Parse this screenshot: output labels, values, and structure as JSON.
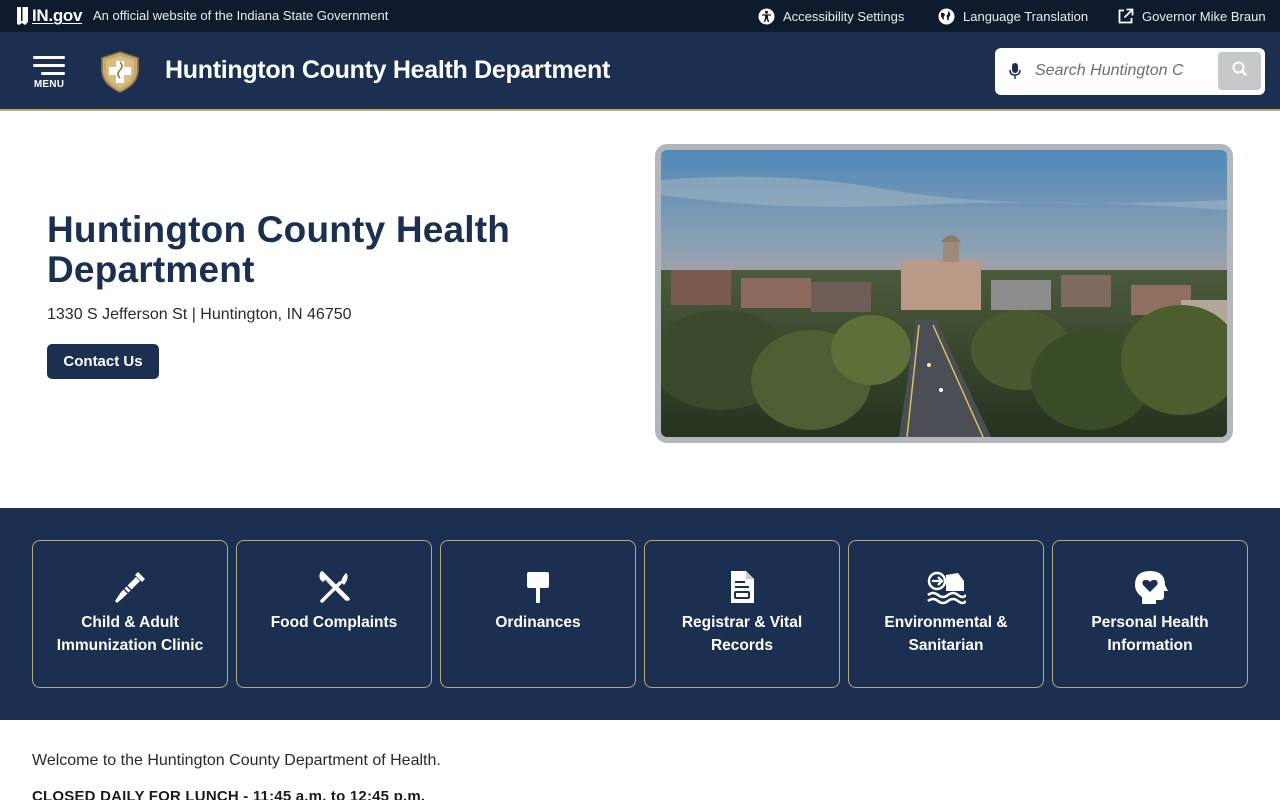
{
  "statebar": {
    "logo_text": "IN.gov",
    "official_text": "An official website of the Indiana State Government",
    "links": [
      {
        "label": "Accessibility Settings",
        "icon": "accessibility-icon"
      },
      {
        "label": "Language Translation",
        "icon": "globe-icon"
      },
      {
        "label": "Governor Mike Braun",
        "icon": "external-link-icon"
      }
    ]
  },
  "header": {
    "menu_label": "MENU",
    "site_title": "Huntington County Health Department",
    "search_placeholder": "Search Huntington C"
  },
  "hero": {
    "title": "Huntington County Health Department",
    "address": "1330 S Jefferson St | Huntington, IN 46750",
    "contact_label": "Contact Us"
  },
  "quick_links": [
    {
      "label": "Child & Adult Immunization Clinic",
      "icon": "syringe-icon"
    },
    {
      "label": "Food Complaints",
      "icon": "utensils-icon"
    },
    {
      "label": "Ordinances",
      "icon": "sign-icon"
    },
    {
      "label": "Registrar & Vital Records",
      "icon": "document-icon"
    },
    {
      "label": "Environmental & Sanitarian",
      "icon": "house-water-icon"
    },
    {
      "label": "Personal Health Information",
      "icon": "head-heart-icon"
    }
  ],
  "content": {
    "welcome": "Welcome to the Huntington County Department of Health.",
    "lunch": "CLOSED DAILY FOR LUNCH - 11:45 a.m. to 12:45 p.m."
  },
  "colors": {
    "navy": "#1b2f50",
    "statebar": "#0e1b2c",
    "gold_border": "#b9a774"
  }
}
